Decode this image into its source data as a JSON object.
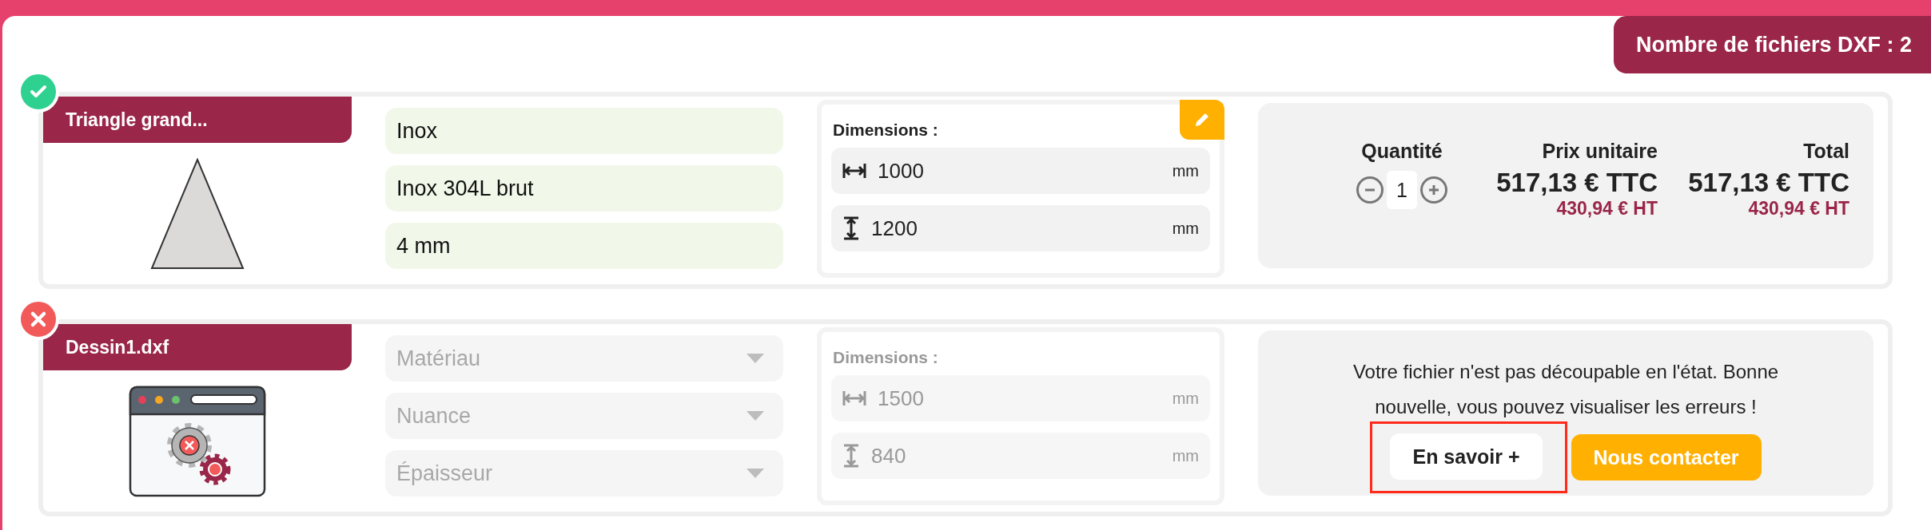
{
  "file_count": {
    "label": "Nombre de fichiers DXF : 2"
  },
  "files": [
    {
      "valid": true,
      "name": "Triangle grand...",
      "preview": {
        "kind": "triangle"
      },
      "fields": [
        {
          "kind": "value",
          "text": "Inox"
        },
        {
          "kind": "value",
          "text": "Inox 304L brut"
        },
        {
          "kind": "value",
          "text": "4 mm"
        }
      ],
      "dimensions": {
        "label": "Dimensions :",
        "disabled": false,
        "editable": true,
        "rows": [
          {
            "kind": "horizontal",
            "value": "1000",
            "unit": "mm"
          },
          {
            "kind": "vertical",
            "value": "1200",
            "unit": "mm"
          }
        ]
      },
      "summary": {
        "kind": "pricing",
        "quantity_label": "Quantité",
        "quantity": "1",
        "prices": [
          {
            "label": "Prix unitaire",
            "ttc": "517,13 € TTC",
            "ht": "430,94 € HT"
          },
          {
            "label": "Total",
            "ttc": "517,13 € TTC",
            "ht": "430,94 € HT"
          }
        ]
      }
    },
    {
      "valid": false,
      "name": "Dessin1.dxf",
      "preview": {
        "kind": "error-window"
      },
      "fields": [
        {
          "kind": "select",
          "placeholder": "Matériau",
          "disabled": true
        },
        {
          "kind": "select",
          "placeholder": "Nuance",
          "disabled": true
        },
        {
          "kind": "select",
          "placeholder": "Épaisseur",
          "disabled": true
        }
      ],
      "dimensions": {
        "label": "Dimensions :",
        "disabled": true,
        "editable": false,
        "rows": [
          {
            "kind": "horizontal",
            "value": "1500",
            "unit": "mm"
          },
          {
            "kind": "vertical",
            "value": "840",
            "unit": "mm"
          }
        ]
      },
      "summary": {
        "kind": "message",
        "text": "Votre fichier n'est pas découpable en l'état. Bonne nouvelle, vous pouvez visualiser les erreurs !",
        "actions": [
          {
            "kind": "secondary",
            "label": "En savoir +",
            "highlighted": true
          },
          {
            "kind": "primary",
            "label": "Nous contacter",
            "highlighted": false
          }
        ]
      }
    }
  ]
}
